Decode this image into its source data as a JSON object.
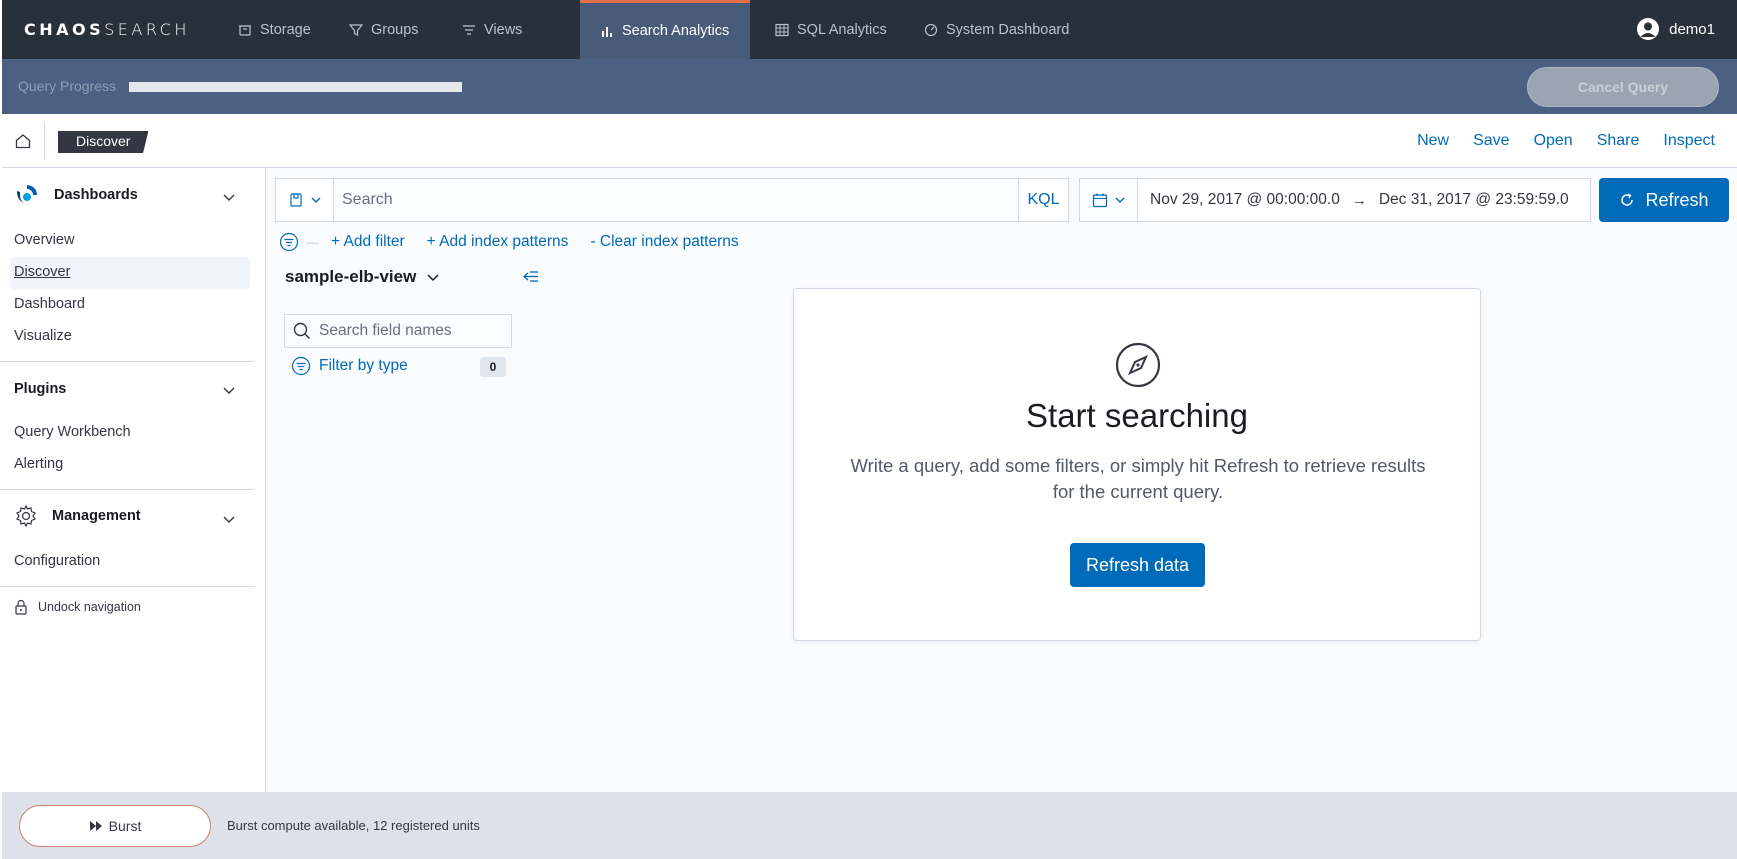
{
  "app": {
    "logo_bold": "CHAOS",
    "logo_light": "SEARCH"
  },
  "nav": {
    "tabs": [
      {
        "label": "Storage",
        "icon": "storage-icon"
      },
      {
        "label": "Groups",
        "icon": "funnel-icon"
      },
      {
        "label": "Views",
        "icon": "list-icon"
      },
      {
        "label": "Search Analytics",
        "icon": "bar-chart-icon",
        "active": true
      },
      {
        "label": "SQL Analytics",
        "icon": "table-icon"
      },
      {
        "label": "System Dashboard",
        "icon": "dashboard-icon"
      }
    ],
    "user": "demo1"
  },
  "progress": {
    "label": "Query Progress",
    "value": 1.0,
    "cancel_label": "Cancel Query"
  },
  "header": {
    "breadcrumb": "Discover",
    "actions": [
      "New",
      "Save",
      "Open",
      "Share",
      "Inspect"
    ]
  },
  "sidebar": {
    "dashboards": {
      "title": "Dashboards",
      "items": [
        "Overview",
        "Discover",
        "Dashboard",
        "Visualize"
      ]
    },
    "plugins": {
      "title": "Plugins",
      "items": [
        "Query Workbench",
        "Alerting"
      ]
    },
    "management": {
      "title": "Management",
      "items": [
        "Configuration"
      ]
    },
    "undock_label": "Undock navigation"
  },
  "query": {
    "placeholder": "Search",
    "language": "KQL",
    "date_start": "Nov 29, 2017 @ 00:00:00.0",
    "date_arrow": "→",
    "date_end": "Dec 31, 2017 @ 23:59:59.0",
    "refresh_label": "Refresh"
  },
  "filters": {
    "add_filter": "+ Add filter",
    "add_index": "+ Add index patterns",
    "clear_index": "- Clear index patterns"
  },
  "fields": {
    "index_name": "sample-elb-view",
    "search_placeholder": "Search field names",
    "filter_by_type": "Filter by type",
    "filter_count": "0"
  },
  "empty": {
    "title": "Start searching",
    "body": "Write a query, add some filters, or simply hit Refresh to retrieve results for the current query.",
    "button": "Refresh data"
  },
  "footer": {
    "burst_label": "Burst",
    "burst_status": "Burst compute available, 12 registered units"
  },
  "colors": {
    "nav_bg": "#28313a",
    "active_tab": "#485c7a",
    "accent_orange": "#e6704e",
    "progress_bg": "#4c6182",
    "primary": "#006bb8"
  }
}
